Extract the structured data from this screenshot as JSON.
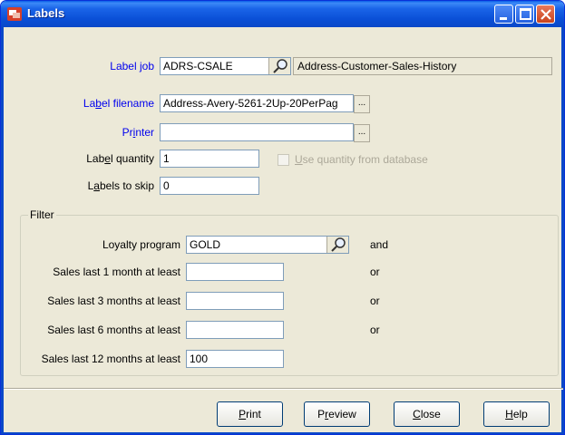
{
  "window": {
    "title": "Labels",
    "colors": {
      "titlebar": "#0a4fd6",
      "body": "#ece9d8",
      "label_link": "#0000ee"
    }
  },
  "form": {
    "label_job": {
      "label_prefix": "Label ",
      "label_underline": "j",
      "label_suffix": "ob",
      "value": "ADRS-CSALE",
      "description": "Address-Customer-Sales-History"
    },
    "label_filename": {
      "label_prefix": "La",
      "label_underline": "b",
      "label_suffix": "el filename",
      "value": "Address-Avery-5261-2Up-20PerPag",
      "button": "..."
    },
    "printer": {
      "label_prefix": "Pr",
      "label_underline": "i",
      "label_suffix": "nter",
      "value": "",
      "button": "..."
    },
    "label_quantity": {
      "label_prefix": "Lab",
      "label_underline": "e",
      "label_suffix": "l quantity",
      "value": "1"
    },
    "use_quantity": {
      "label_underline": "U",
      "label_suffix": "se quantity from database",
      "checked": false
    },
    "labels_to_skip": {
      "label_prefix": "L",
      "label_underline": "a",
      "label_suffix": "bels to skip",
      "value": "0"
    }
  },
  "filter": {
    "title": "Filter",
    "loyalty": {
      "label": "Loyalty program",
      "value": "GOLD",
      "conj": "and"
    },
    "rows": [
      {
        "label": "Sales last  1 month at least",
        "value": "",
        "conj": "or"
      },
      {
        "label": "Sales last  3 months at least",
        "value": "",
        "conj": "or"
      },
      {
        "label": "Sales last  6 months at least",
        "value": "",
        "conj": "or"
      },
      {
        "label": "Sales last 12 months at least",
        "value": "100",
        "conj": ""
      }
    ]
  },
  "buttons": {
    "print": {
      "underline": "P",
      "rest": "rint"
    },
    "preview": {
      "prefix": "P",
      "underline": "r",
      "rest": "eview"
    },
    "close": {
      "underline": "C",
      "rest": "lose"
    },
    "help": {
      "underline": "H",
      "rest": "elp"
    }
  },
  "icons": [
    "app-icon",
    "minimize-icon",
    "maximize-icon",
    "close-icon",
    "magnifier-icon",
    "ellipsis-icon",
    "checkbox-icon"
  ]
}
